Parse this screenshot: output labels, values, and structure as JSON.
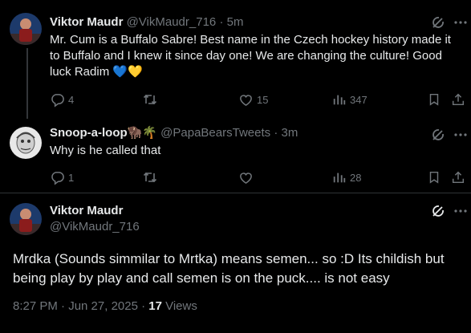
{
  "reply1": {
    "name": "Viktor Maudr",
    "handle": "@VikMaudr_716",
    "sep": "·",
    "time": "5m",
    "text": "Mr. Cum is a Buffalo Sabre! Best name in the Czech hockey history made it to Buffalo and I knew it since day one! We are changing the culture! Good luck Radim 💙💛",
    "replies": "4",
    "retweets": "",
    "likes": "15",
    "views": "347"
  },
  "reply2": {
    "name": "Snoop-a-loop🦬🌴",
    "handle": "@PapaBearsTweets",
    "sep": "·",
    "time": "3m",
    "text": "Why is he called that",
    "replies": "1",
    "retweets": "",
    "likes": "",
    "views": "28"
  },
  "main": {
    "name": "Viktor Maudr",
    "handle": "@VikMaudr_716",
    "text": "Mrdka (Sounds simmilar to Mrtka) means semen... so :D Its childish but being play by play and call semen is on the puck.... is not easy",
    "date": "8:27 PM · Jun 27, 2025 · ",
    "views_count": "17",
    "views_label": " Views"
  },
  "colors": {
    "background": "#000000",
    "text": "#e7e9ea",
    "muted": "#71767b",
    "divider": "#2f3336"
  },
  "icons": {
    "grok": "grok-icon",
    "reply": "reply-icon",
    "retweet": "retweet-icon",
    "like": "heart-icon",
    "views": "views-icon",
    "bookmark": "bookmark-icon",
    "share": "share-icon",
    "more": "more-icon"
  }
}
